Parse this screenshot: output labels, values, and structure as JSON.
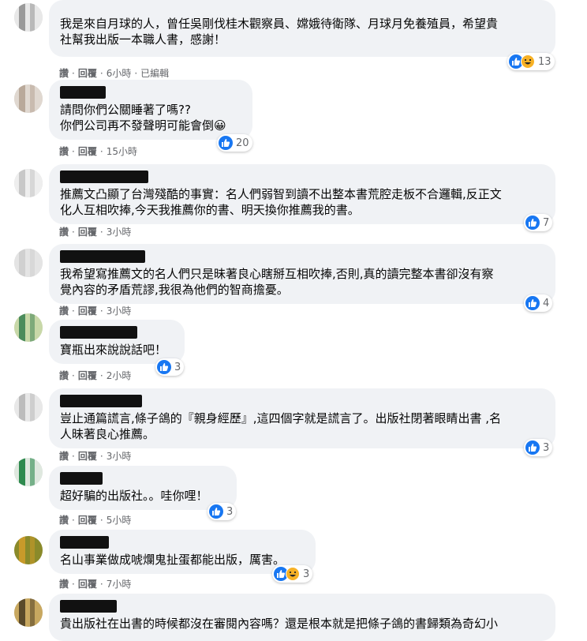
{
  "comments": [
    {
      "text": "我是來自月球的人，曾任吳剛伐桂木觀察員、嫦娥待衛隊、月球月免養殖員，希望貴\n社幫我出版一本職人書，感謝！",
      "like": "讚",
      "reply": "回覆",
      "time": "6小時",
      "edited": "已編輯",
      "reaction_count": "13",
      "reactions": [
        "like",
        "haha"
      ],
      "avatar_colors": [
        "#9a9a9a",
        "#e8e8e8"
      ]
    },
    {
      "text": "請問你們公關睡著了嗎??\n你們公司再不發聲明可能會倒😀",
      "like": "讚",
      "reply": "回覆",
      "time": "15小時",
      "reaction_count": "20",
      "reactions": [
        "like"
      ],
      "avatar_colors": [
        "#b9a99a",
        "#e0d8d0"
      ]
    },
    {
      "text": "推薦文凸顯了台灣殘酷的事實：名人們弱智到讀不出整本書荒腔走板不合邏輯,反正文\n化人互相吹捧,今天我推薦你的書、明天換你推薦我的書。",
      "like": "讚",
      "reply": "回覆",
      "time": "3小時",
      "reaction_count": "7",
      "reactions": [
        "like"
      ],
      "avatar_colors": [
        "#c8c8c8",
        "#eeeeee"
      ]
    },
    {
      "text": "我希望寫推薦文的名人們只是昧著良心瞎掰互相吹捧,否則,真的讀完整本書卻沒有察\n覺內容的矛盾荒謬,我很為他們的智商擔憂。",
      "like": "讚",
      "reply": "回覆",
      "time": "3小時",
      "reaction_count": "4",
      "reactions": [
        "like"
      ],
      "avatar_colors": [
        "#d0d0d0",
        "#e4e4e4"
      ]
    },
    {
      "text": "寶瓶出來說說話吧！",
      "like": "讚",
      "reply": "回覆",
      "time": "2小時",
      "reaction_count": "3",
      "reactions": [
        "like"
      ],
      "avatar_colors": [
        "#4c8c5c",
        "#c8d8a8"
      ]
    },
    {
      "text": "豈止通篇謊言,條子鴿的『親身經歷』,這四個字就是謊言了。出版社閉著眼睛出書 ,名\n人昧著良心推薦。",
      "like": "讚",
      "reply": "回覆",
      "time": "3小時",
      "reaction_count": "3",
      "reactions": [
        "like"
      ],
      "avatar_colors": [
        "#bcbcbc",
        "#e8e8e8"
      ]
    },
    {
      "text": "超好騙的出版社。。哇你哩！",
      "like": "讚",
      "reply": "回覆",
      "time": "5小時",
      "reaction_count": "3",
      "reactions": [
        "like"
      ],
      "avatar_colors": [
        "#2e8a4e",
        "#dfe8df"
      ]
    },
    {
      "text": "名山事業做成唬爛鬼扯蛋都能出版，厲害。",
      "like": "讚",
      "reply": "回覆",
      "time": "7小時",
      "reaction_count": "3",
      "reactions": [
        "like",
        "haha"
      ],
      "avatar_colors": [
        "#c89a2a",
        "#8a8a2a"
      ]
    },
    {
      "text": "貴出版社在出書的時候都沒在審閱內容嗎？還是根本就是把條子鴿的書歸類為奇幻小",
      "like": "",
      "reply": "",
      "time": "",
      "reaction_count": "",
      "reactions": [],
      "avatar_colors": [
        "#5a4a2a",
        "#c8a860"
      ]
    }
  ]
}
